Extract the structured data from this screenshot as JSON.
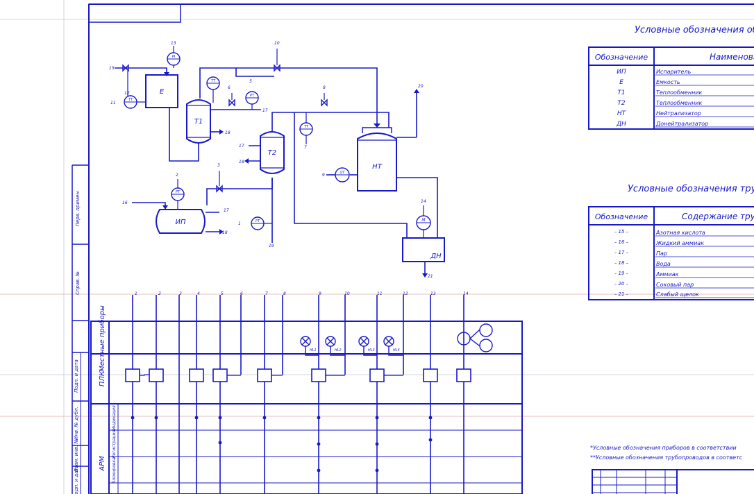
{
  "legend_devices": {
    "title": "Условные обозначения обо",
    "header": [
      "Обозначение",
      "Наименова"
    ],
    "rows": [
      [
        "ИП",
        "Испаритель"
      ],
      [
        "Е",
        "Емкость"
      ],
      [
        "Т1",
        "Теплообменник"
      ],
      [
        "Т2",
        "Теплообменник"
      ],
      [
        "НТ",
        "Нейтрализатор"
      ],
      [
        "ДН",
        "Донейтрализатор"
      ]
    ]
  },
  "legend_pipes": {
    "title": "Условные обозначения труб",
    "header": [
      "Обозначение",
      "Содержание тру"
    ],
    "rows": [
      [
        "– 15 –",
        "Азотная кислота"
      ],
      [
        "– 16 –",
        "Жидкий аммиак"
      ],
      [
        "– 17 –",
        "Пар"
      ],
      [
        "– 18 –",
        "Вода"
      ],
      [
        "– 19 –",
        "Аммиак"
      ],
      [
        "– 20 –",
        "Соковый пар"
      ],
      [
        "– 21 –",
        "Слабый щелок"
      ]
    ]
  },
  "footnotes": [
    "*Условные обозначения приборов в соответствии",
    "**Условные обозначения трубопроводов в соответс"
  ],
  "equipment": {
    "e": "Е",
    "t1": "Т1",
    "t2": "Т2",
    "ip": "ИП",
    "nt": "НТ",
    "dn": "ДН"
  },
  "stream_labels": {
    "s15": "15",
    "s11": "11",
    "s12": "12",
    "s13": "13",
    "s10": "10",
    "s6": "6",
    "s5": "5",
    "s17a": "17",
    "s18a": "18",
    "s8": "8",
    "s7": "7",
    "s17b": "17",
    "s18b": "18",
    "s20": "20",
    "s9": "9",
    "s14": "14",
    "s21": "21",
    "s16": "16",
    "s2": "2",
    "s3": "3",
    "s17c": "17",
    "s18c": "18",
    "s1": "1",
    "s19": "19"
  },
  "instruments": {
    "i13": "PI",
    "i11": "TT",
    "i5": "PT",
    "i7a": "TT",
    "i7b": "TT",
    "i2": "PT",
    "i1": "PT",
    "i9": "QT",
    "i14": "M"
  },
  "channels": [
    "1",
    "2",
    "3",
    "4",
    "5",
    "6",
    "7",
    "8",
    "9",
    "10",
    "11",
    "12",
    "13",
    "14"
  ],
  "panel": {
    "local": "Местные приборы",
    "plc": "ПЛК",
    "arm": "АРМ",
    "arm_rows": [
      "Индикация",
      "Регистрация",
      "Блокировка"
    ],
    "lamps": [
      "НL1",
      "НL2",
      "НL3",
      "НL4"
    ]
  },
  "side_stamps": [
    "Перв. примен.",
    "Справ. №",
    "Подп. и дата",
    "Инв. № дубл.",
    "Взам. инв. №",
    "Подп. и дата"
  ]
}
